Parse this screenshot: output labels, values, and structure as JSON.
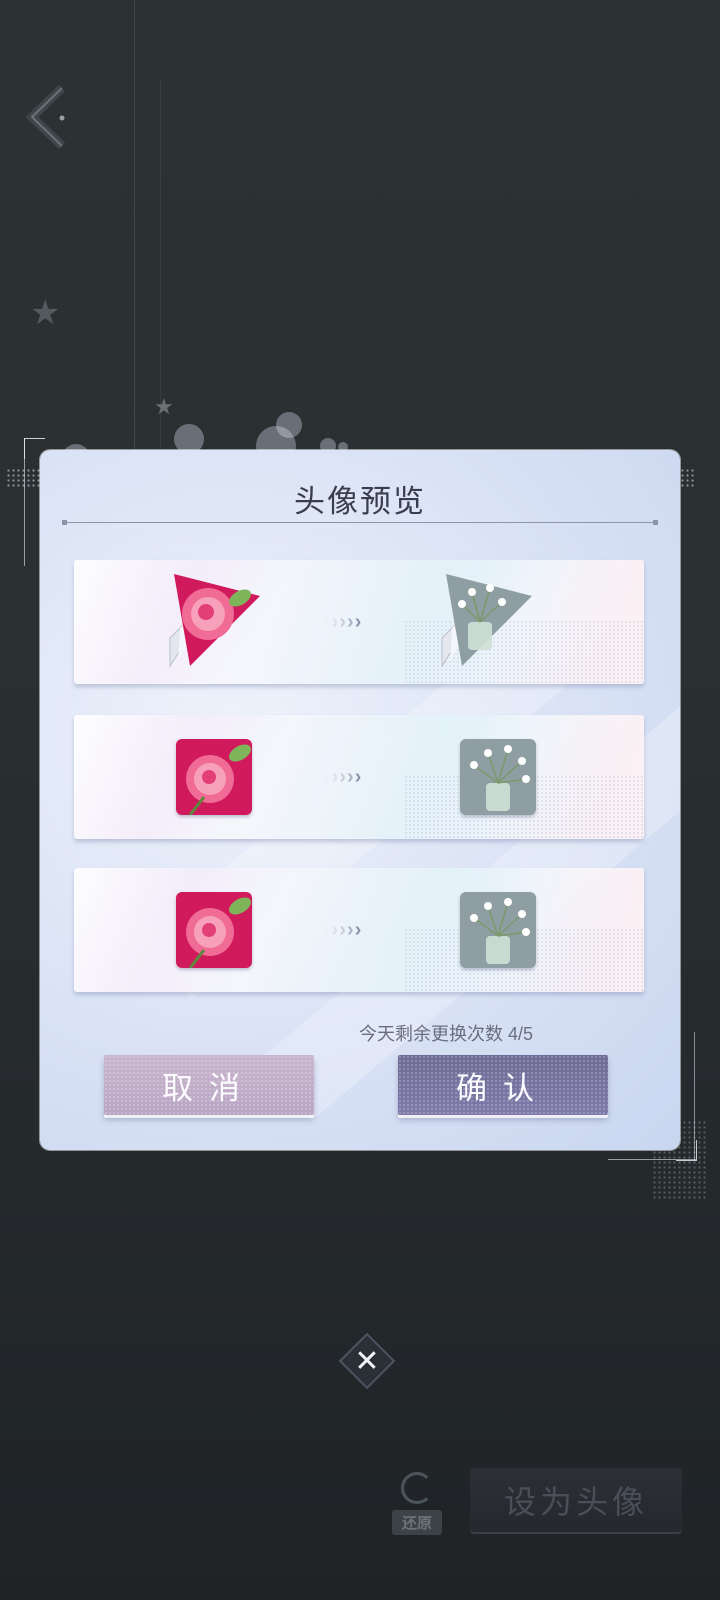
{
  "dialog": {
    "title": "头像预览",
    "rows": [
      {
        "style": "triangle-frame",
        "from": "peony-avatar",
        "to": "white-flower-vase-avatar"
      },
      {
        "style": "square-large",
        "from": "peony-avatar",
        "to": "white-flower-vase-avatar"
      },
      {
        "style": "square-small",
        "from": "peony-avatar",
        "to": "white-flower-vase-avatar"
      }
    ],
    "arrows": "›››››",
    "remaining_label": "今天剩余更换次数 4/5",
    "cancel_label": "取消",
    "confirm_label": "确认"
  },
  "bottom_bar": {
    "restore_label": "还原",
    "set_avatar_label": "设为头像"
  },
  "colors": {
    "peony_bg": "#d01a5c",
    "vase_bg": "#8f9ea3",
    "cancel_btn": "#c0aec8",
    "confirm_btn": "#77739f"
  }
}
